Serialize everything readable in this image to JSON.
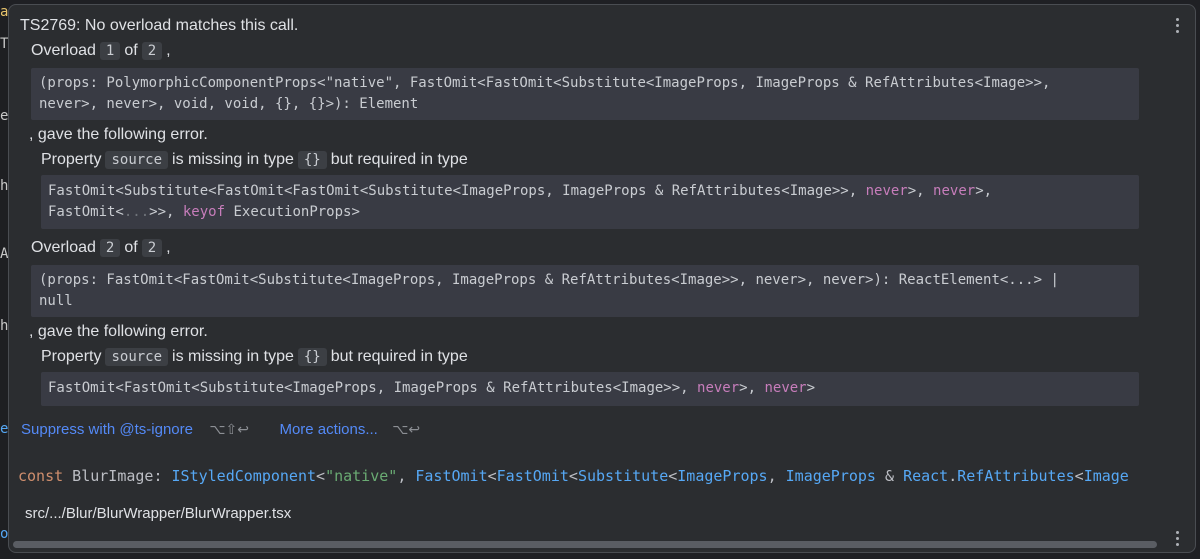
{
  "editor": {
    "gutter": [
      "a",
      "T",
      "e",
      "h",
      "A",
      "h",
      "e",
      "o"
    ]
  },
  "popup": {
    "title": "TS2769: No overload matches this call.",
    "overloads": [
      {
        "label": "Overload",
        "index": "1",
        "of": "of",
        "total": "2",
        "comma": ",",
        "signature": [
          "(props: PolymorphicComponentProps<\"native\", FastOmit<FastOmit<Substitute<ImageProps, ImageProps & RefAttributes<Image>>,",
          "never>, never>, void, void, {}, {}>): Element"
        ],
        "gave": ", gave the following error.",
        "property_label": "Property",
        "property": "source",
        "missing": "is missing in type",
        "type_chip": "{}",
        "required": "but required in type",
        "required_line1_a": "FastOmit<Substitute<FastOmit<FastOmit<Substitute<ImageProps, ImageProps & RefAttributes<Image>>, ",
        "kw_never": "never",
        "sep": ">, ",
        "kw_never2": "never",
        "tail1": ">,",
        "required_line2_a": "FastOmit<",
        "ellipsis": "...",
        "required_line2_b": ">>, ",
        "kw_keyof": "keyof",
        "required_line2_c": " ExecutionProps>"
      },
      {
        "label": "Overload",
        "index": "2",
        "of": "of",
        "total": "2",
        "comma": ",",
        "signature": [
          "(props: FastOmit<FastOmit<Substitute<ImageProps, ImageProps & RefAttributes<Image>>, never>, never>): ReactElement<...> |",
          "null"
        ],
        "gave": ", gave the following error.",
        "property_label": "Property",
        "property": "source",
        "missing": "is missing in type",
        "type_chip": "{}",
        "required": "but required in type",
        "required_line1_a": "FastOmit<FastOmit<Substitute<ImageProps, ImageProps & RefAttributes<Image>>, ",
        "kw_never": "never",
        "sep": ">, ",
        "kw_never2": "never",
        "tail1": ">"
      }
    ],
    "actions": {
      "suppress": "Suppress with @ts-ignore",
      "suppress_shortcut": "⌥⇧↩",
      "more": "More actions...",
      "more_shortcut": "⌥↩"
    },
    "declaration": {
      "kw": "const",
      "name": " BlurImage: ",
      "type": "IStyledComponent",
      "p1": "<",
      "str": "\"native\"",
      "p2": ", ",
      "t2": "FastOmit",
      "p3": "<",
      "t3": "FastOmit",
      "p4": "<",
      "t4": "Substitute",
      "p5": "<",
      "t5": "ImageProps",
      "p6": ", ",
      "t6": "ImageProps",
      "p7": " & ",
      "t7": "React",
      "p8": ".",
      "t8": "RefAttributes",
      "p9": "<",
      "t9": "Image"
    },
    "path": "src/.../Blur/BlurWrapper/BlurWrapper.tsx"
  },
  "colors": {
    "background": "#2b2d30",
    "code_bg": "#393b44",
    "link": "#548af7",
    "keyword": "#c77dbb"
  }
}
